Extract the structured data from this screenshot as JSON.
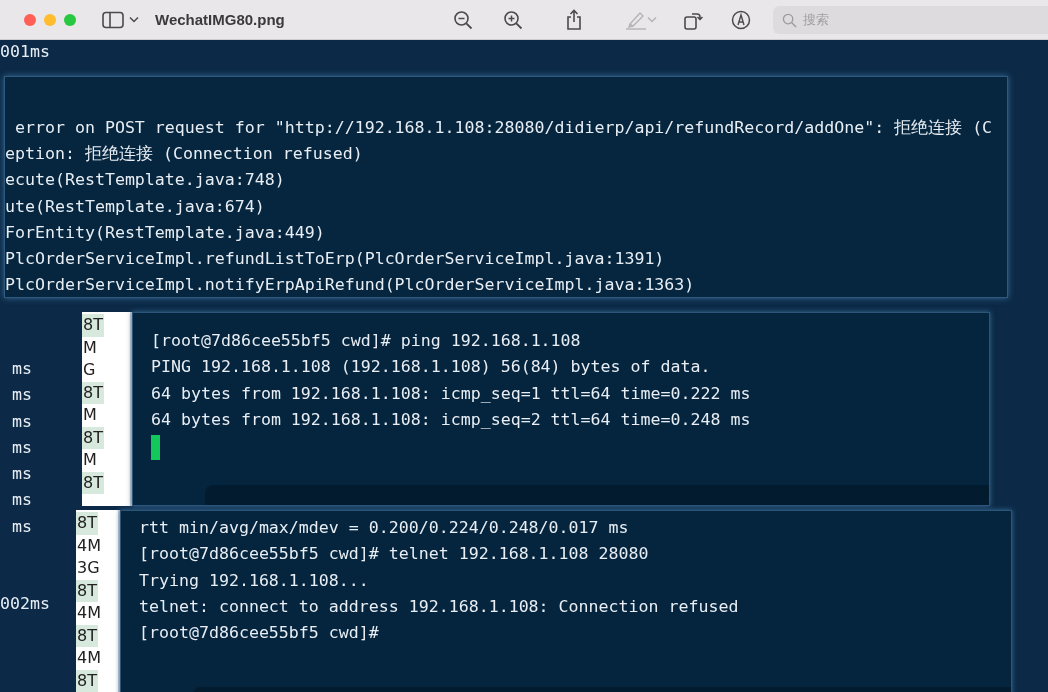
{
  "window": {
    "title": "WechatIMG80.png",
    "search": {
      "placeholder": "搜索"
    },
    "toolbar": [
      {
        "kind": "sidebar",
        "disabled": false
      },
      {
        "kind": "chevron",
        "disabled": false
      },
      {
        "kind": "zoom-out",
        "disabled": false
      },
      {
        "kind": "zoom-in",
        "disabled": false
      },
      {
        "kind": "share",
        "disabled": false
      },
      {
        "kind": "highlight",
        "disabled": true
      },
      {
        "kind": "chevron",
        "disabled": true
      },
      {
        "kind": "rotate",
        "disabled": false
      },
      {
        "kind": "markup",
        "disabled": false
      }
    ]
  },
  "background_log": {
    "top_line": "001ms",
    "times": [
      "ms",
      "ms",
      "ms",
      "ms",
      "ms",
      "ms",
      "ms"
    ],
    "bottom_line": "002ms"
  },
  "log_panel": {
    "lines": [
      " error on POST request for \"http://192.168.1.108:28080/didierp/api/refundRecord/addOne\": 拒绝连接 (C",
      "eption: 拒绝连接 (Connection refused)",
      "ecute(RestTemplate.java:748)",
      "ute(RestTemplate.java:674)",
      "ForEntity(RestTemplate.java:449)",
      "PlcOrderServiceImpl.refundListToErp(PlcOrderServiceImpl.java:1391)",
      "PlcOrderServiceImpl.notifyErpApiRefund(PlcOrderServiceImpl.java:1363)"
    ]
  },
  "terminals": [
    {
      "side": [
        {
          "label": "8T",
          "highlighted": true
        },
        {
          "label": "M",
          "highlighted": false
        },
        {
          "label": "G",
          "highlighted": false
        },
        {
          "label": "8T",
          "highlighted": true
        },
        {
          "label": "M",
          "highlighted": false
        },
        {
          "label": "8T",
          "highlighted": true
        },
        {
          "label": "M",
          "highlighted": false
        },
        {
          "label": "8T",
          "highlighted": true
        }
      ],
      "lines": [
        "[root@7d86cee55bf5 cwd]# ping 192.168.1.108",
        "PING 192.168.1.108 (192.168.1.108) 56(84) bytes of data.",
        "64 bytes from 192.168.1.108: icmp_seq=1 ttl=64 time=0.222 ms",
        "64 bytes from 192.168.1.108: icmp_seq=2 ttl=64 time=0.248 ms"
      ],
      "cursor": true
    },
    {
      "side": [
        {
          "label": "8T",
          "highlighted": true
        },
        {
          "label": "4M",
          "highlighted": false
        },
        {
          "label": "3G",
          "highlighted": false
        },
        {
          "label": "8T",
          "highlighted": true
        },
        {
          "label": "4M",
          "highlighted": false
        },
        {
          "label": "8T",
          "highlighted": true
        },
        {
          "label": "4M",
          "highlighted": false
        },
        {
          "label": "8T",
          "highlighted": true
        }
      ],
      "lines": [
        "rtt min/avg/max/mdev = 0.200/0.224/0.248/0.017 ms",
        "[root@7d86cee55bf5 cwd]# telnet 192.168.1.108 28080",
        "Trying 192.168.1.108...",
        "telnet: connect to address 192.168.1.108: Connection refused",
        "[root@7d86cee55bf5 cwd]#"
      ],
      "cursor": false
    }
  ]
}
